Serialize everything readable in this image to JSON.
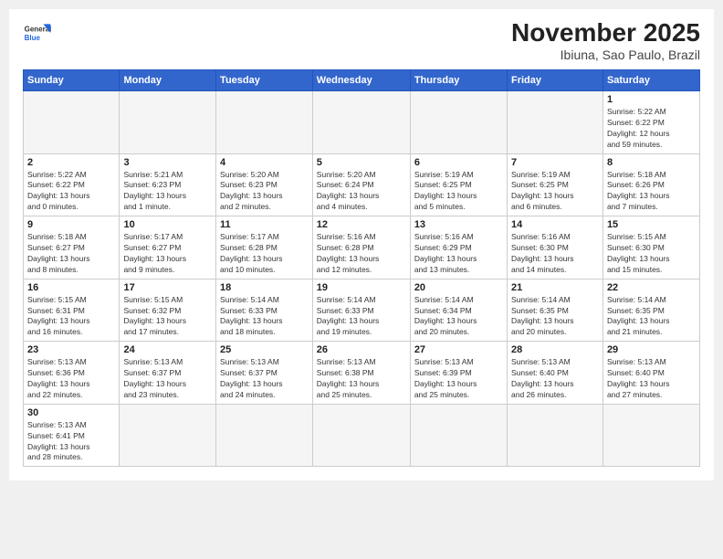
{
  "header": {
    "logo_general": "General",
    "logo_blue": "Blue",
    "title": "November 2025",
    "location": "Ibiuna, Sao Paulo, Brazil"
  },
  "weekdays": [
    "Sunday",
    "Monday",
    "Tuesday",
    "Wednesday",
    "Thursday",
    "Friday",
    "Saturday"
  ],
  "weeks": [
    [
      {
        "day": "",
        "info": ""
      },
      {
        "day": "",
        "info": ""
      },
      {
        "day": "",
        "info": ""
      },
      {
        "day": "",
        "info": ""
      },
      {
        "day": "",
        "info": ""
      },
      {
        "day": "",
        "info": ""
      },
      {
        "day": "1",
        "info": "Sunrise: 5:22 AM\nSunset: 6:22 PM\nDaylight: 12 hours\nand 59 minutes."
      }
    ],
    [
      {
        "day": "2",
        "info": "Sunrise: 5:22 AM\nSunset: 6:22 PM\nDaylight: 13 hours\nand 0 minutes."
      },
      {
        "day": "3",
        "info": "Sunrise: 5:21 AM\nSunset: 6:23 PM\nDaylight: 13 hours\nand 1 minute."
      },
      {
        "day": "4",
        "info": "Sunrise: 5:20 AM\nSunset: 6:23 PM\nDaylight: 13 hours\nand 2 minutes."
      },
      {
        "day": "5",
        "info": "Sunrise: 5:20 AM\nSunset: 6:24 PM\nDaylight: 13 hours\nand 4 minutes."
      },
      {
        "day": "6",
        "info": "Sunrise: 5:19 AM\nSunset: 6:25 PM\nDaylight: 13 hours\nand 5 minutes."
      },
      {
        "day": "7",
        "info": "Sunrise: 5:19 AM\nSunset: 6:25 PM\nDaylight: 13 hours\nand 6 minutes."
      },
      {
        "day": "8",
        "info": "Sunrise: 5:18 AM\nSunset: 6:26 PM\nDaylight: 13 hours\nand 7 minutes."
      }
    ],
    [
      {
        "day": "9",
        "info": "Sunrise: 5:18 AM\nSunset: 6:27 PM\nDaylight: 13 hours\nand 8 minutes."
      },
      {
        "day": "10",
        "info": "Sunrise: 5:17 AM\nSunset: 6:27 PM\nDaylight: 13 hours\nand 9 minutes."
      },
      {
        "day": "11",
        "info": "Sunrise: 5:17 AM\nSunset: 6:28 PM\nDaylight: 13 hours\nand 10 minutes."
      },
      {
        "day": "12",
        "info": "Sunrise: 5:16 AM\nSunset: 6:28 PM\nDaylight: 13 hours\nand 12 minutes."
      },
      {
        "day": "13",
        "info": "Sunrise: 5:16 AM\nSunset: 6:29 PM\nDaylight: 13 hours\nand 13 minutes."
      },
      {
        "day": "14",
        "info": "Sunrise: 5:16 AM\nSunset: 6:30 PM\nDaylight: 13 hours\nand 14 minutes."
      },
      {
        "day": "15",
        "info": "Sunrise: 5:15 AM\nSunset: 6:30 PM\nDaylight: 13 hours\nand 15 minutes."
      }
    ],
    [
      {
        "day": "16",
        "info": "Sunrise: 5:15 AM\nSunset: 6:31 PM\nDaylight: 13 hours\nand 16 minutes."
      },
      {
        "day": "17",
        "info": "Sunrise: 5:15 AM\nSunset: 6:32 PM\nDaylight: 13 hours\nand 17 minutes."
      },
      {
        "day": "18",
        "info": "Sunrise: 5:14 AM\nSunset: 6:33 PM\nDaylight: 13 hours\nand 18 minutes."
      },
      {
        "day": "19",
        "info": "Sunrise: 5:14 AM\nSunset: 6:33 PM\nDaylight: 13 hours\nand 19 minutes."
      },
      {
        "day": "20",
        "info": "Sunrise: 5:14 AM\nSunset: 6:34 PM\nDaylight: 13 hours\nand 20 minutes."
      },
      {
        "day": "21",
        "info": "Sunrise: 5:14 AM\nSunset: 6:35 PM\nDaylight: 13 hours\nand 20 minutes."
      },
      {
        "day": "22",
        "info": "Sunrise: 5:14 AM\nSunset: 6:35 PM\nDaylight: 13 hours\nand 21 minutes."
      }
    ],
    [
      {
        "day": "23",
        "info": "Sunrise: 5:13 AM\nSunset: 6:36 PM\nDaylight: 13 hours\nand 22 minutes."
      },
      {
        "day": "24",
        "info": "Sunrise: 5:13 AM\nSunset: 6:37 PM\nDaylight: 13 hours\nand 23 minutes."
      },
      {
        "day": "25",
        "info": "Sunrise: 5:13 AM\nSunset: 6:37 PM\nDaylight: 13 hours\nand 24 minutes."
      },
      {
        "day": "26",
        "info": "Sunrise: 5:13 AM\nSunset: 6:38 PM\nDaylight: 13 hours\nand 25 minutes."
      },
      {
        "day": "27",
        "info": "Sunrise: 5:13 AM\nSunset: 6:39 PM\nDaylight: 13 hours\nand 25 minutes."
      },
      {
        "day": "28",
        "info": "Sunrise: 5:13 AM\nSunset: 6:40 PM\nDaylight: 13 hours\nand 26 minutes."
      },
      {
        "day": "29",
        "info": "Sunrise: 5:13 AM\nSunset: 6:40 PM\nDaylight: 13 hours\nand 27 minutes."
      }
    ],
    [
      {
        "day": "30",
        "info": "Sunrise: 5:13 AM\nSunset: 6:41 PM\nDaylight: 13 hours\nand 28 minutes."
      },
      {
        "day": "",
        "info": ""
      },
      {
        "day": "",
        "info": ""
      },
      {
        "day": "",
        "info": ""
      },
      {
        "day": "",
        "info": ""
      },
      {
        "day": "",
        "info": ""
      },
      {
        "day": "",
        "info": ""
      }
    ]
  ]
}
